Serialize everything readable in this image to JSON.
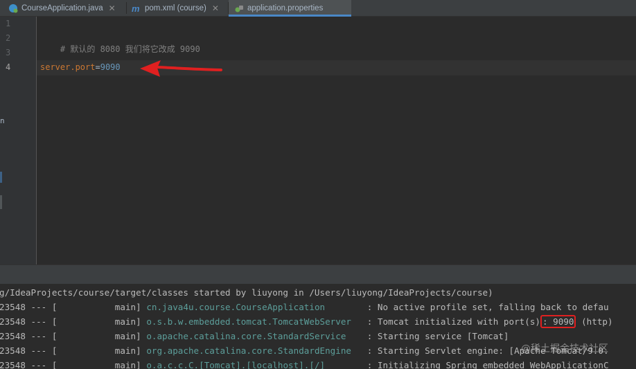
{
  "tabs": [
    {
      "label": "CourseApplication.java",
      "icon": "spring-java-class-icon",
      "closable": true
    },
    {
      "label": "pom.xml (course)",
      "icon": "maven-icon",
      "closable": true
    },
    {
      "label": "application.properties",
      "icon": "spring-properties-icon",
      "active": true
    }
  ],
  "editor": {
    "line_numbers": [
      "1",
      "2",
      "3",
      "4"
    ],
    "lines": {
      "comment": "# 默认的 8080 我们将它改成 9090",
      "key": "server.port",
      "equals": "=",
      "value": "9090"
    },
    "left_char": "n"
  },
  "console": {
    "line0": "g/IdeaProjects/course/target/classes started by liuyong in /Users/liuyong/IdeaProjects/course)",
    "rows": [
      {
        "prefix": "23548 --- [           main] ",
        "logger": "cn.java4u.course.CourseApplication       ",
        "msg": " : No active profile set, falling back to defau"
      },
      {
        "prefix": "23548 --- [           main] ",
        "logger": "o.s.b.w.embedded.tomcat.TomcatWebServer  ",
        "msg": " : Tomcat initialized with port(s)",
        "highlight": ": 9090",
        "tail": " (http)"
      },
      {
        "prefix": "23548 --- [           main] ",
        "logger": "o.apache.catalina.core.StandardService   ",
        "msg": " : Starting service [Tomcat]"
      },
      {
        "prefix": "23548 --- [           main] ",
        "logger": "org.apache.catalina.core.StandardEngine  ",
        "msg": " : Starting Servlet engine: [Apache Tomcat/9.0."
      },
      {
        "prefix": "23548 --- [           main] ",
        "logger": "o.a.c.c.C.[Tomcat].[localhost].[/]       ",
        "msg": " : Initializing Spring embedded WebApplicationC"
      }
    ]
  },
  "watermark": "@稀土掘金技术社区",
  "colors": {
    "annotation": "#e02020",
    "accent": "#4a88c7"
  }
}
